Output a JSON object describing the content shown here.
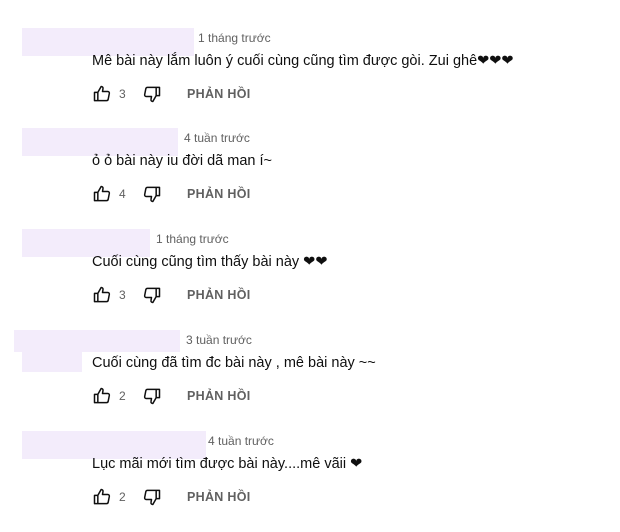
{
  "comments": [
    {
      "time": "1 tháng trước",
      "text": "Mê bài này lắm luôn ý cuối cùng cũng tìm được gòi. Zui ghê❤❤❤",
      "likes": "3",
      "reply_label": "PHẢN HỒI"
    },
    {
      "time": "4 tuần trước",
      "text": "ỏ ỏ bài này iu đời dã man í~",
      "likes": "4",
      "reply_label": "PHẢN HỒI"
    },
    {
      "time": "1 tháng trước",
      "text": "Cuối cùng cũng tìm thấy bài này ❤❤",
      "likes": "3",
      "reply_label": "PHẢN HỒI"
    },
    {
      "time": "3 tuần trước",
      "text": "Cuối cùng đã tìm đc bài này , mê bài này ~~",
      "likes": "2",
      "reply_label": "PHẢN HỒI"
    },
    {
      "time": "4 tuần trước",
      "text": "Lục mãi mới tìm được bài này....mê vãii ❤",
      "likes": "2",
      "reply_label": "PHẢN HỒI"
    }
  ],
  "icons": {
    "like": "thumbs-up-icon",
    "dislike": "thumbs-down-icon"
  },
  "colors": {
    "redacted_name": "#f3ecfb",
    "meta_text": "#606060",
    "body_text": "#0f0f0f"
  }
}
